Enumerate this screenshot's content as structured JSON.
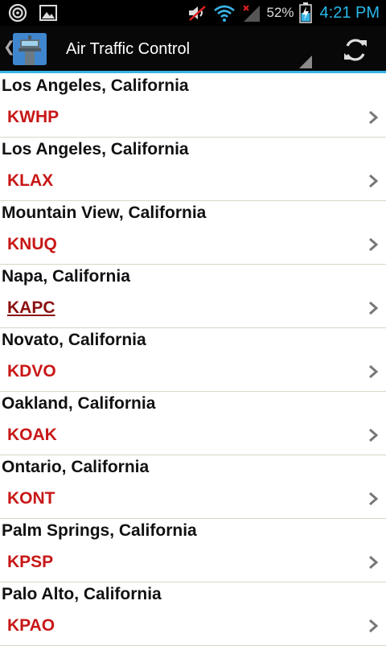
{
  "status_bar": {
    "battery_percent": "52%",
    "time": "4:21 PM",
    "icons": [
      "hotspot-icon",
      "image-icon",
      "mute-icon",
      "wifi-icon",
      "signal-icon",
      "battery-charging-icon"
    ]
  },
  "action_bar": {
    "title": "Air Traffic Control",
    "app_icon": "control-tower-icon",
    "action_icon": "refresh-icon"
  },
  "colors": {
    "accent": "#33b5e5",
    "code_red": "#c81717",
    "clock_blue": "#2ab8ea"
  },
  "airports": [
    {
      "city": "Los Angeles, California",
      "code": "KWHP"
    },
    {
      "city": "Los Angeles, California",
      "code": "KLAX"
    },
    {
      "city": "Mountain View, California",
      "code": "KNUQ"
    },
    {
      "city": "Napa, California",
      "code": "KAPC",
      "visited": true
    },
    {
      "city": "Novato, California",
      "code": "KDVO"
    },
    {
      "city": "Oakland, California",
      "code": "KOAK"
    },
    {
      "city": "Ontario, California",
      "code": "KONT"
    },
    {
      "city": "Palm Springs, California",
      "code": "KPSP"
    },
    {
      "city": "Palo Alto, California",
      "code": "KPAO"
    }
  ]
}
